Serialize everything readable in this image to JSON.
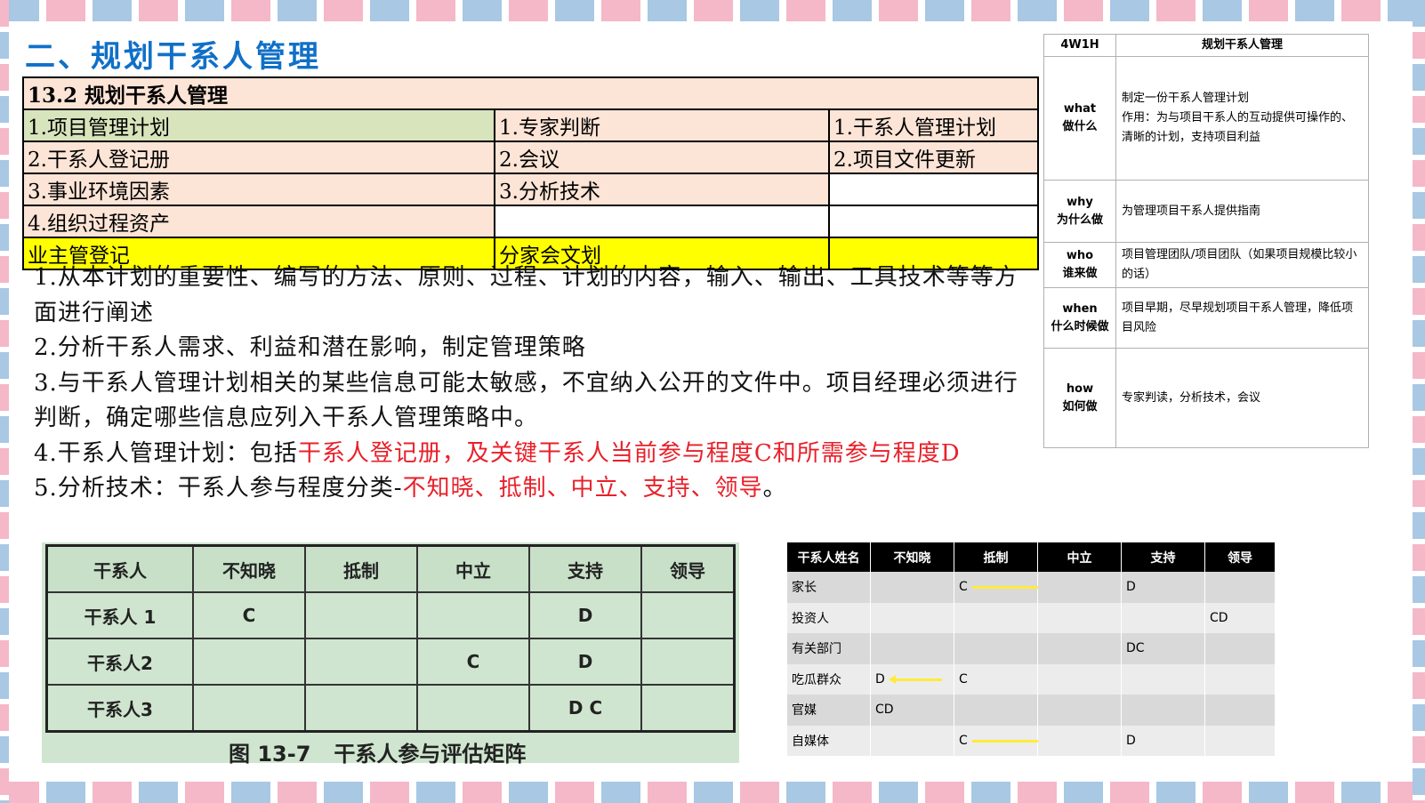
{
  "title": "二、规划干系人管理",
  "itto": {
    "header": "13.2 规划干系人管理",
    "rows": [
      [
        "1.项目管理计划",
        "1.专家判断",
        "1.干系人管理计划"
      ],
      [
        "2.干系人登记册",
        "2.会议",
        "2.项目文件更新"
      ],
      [
        "3.事业环境因素",
        "3.分析技术",
        ""
      ],
      [
        "4.组织过程资产",
        "",
        ""
      ],
      [
        "业主管登记",
        "分家会文划",
        ""
      ]
    ]
  },
  "w4": {
    "header": [
      "4W1H",
      "规划干系人管理"
    ],
    "rows": [
      {
        "k1": "what",
        "k2": "做什么",
        "v": "制定一份干系人管理计划\n作用：为与项目干系人的互动提供可操作的、清晰的计划，支持项目利益"
      },
      {
        "k1": "why",
        "k2": "为什么做",
        "v": "为管理项目干系人提供指南"
      },
      {
        "k1": "who",
        "k2": "谁来做",
        "v": "项目管理团队/项目团队（如果项目规模比较小的话）"
      },
      {
        "k1": "when",
        "k2": "什么时候做",
        "v": "项目早期，尽早规划项目干系人管理，降低项目风险"
      },
      {
        "k1": "how",
        "k2": "如何做",
        "v": "专家判读，分析技术，会议"
      }
    ]
  },
  "notes": {
    "n1": "1.从本计划的重要性、编写的方法、原则、过程、计划的内容，输入、输出、工具技术等等方面进行阐述",
    "n2": "2.分析干系人需求、利益和潜在影响，制定管理策略",
    "n3": "3.与干系人管理计划相关的某些信息可能太敏感，不宜纳入公开的文件中。项目经理必须进行判断，确定哪些信息应列入干系人管理策略中。",
    "n4a": "4.干系人管理计划：包括",
    "n4b": "干系人登记册，及关键干系人当前参与程度C和所需参与程度D",
    "n5a": "5.分析技术：干系人参与程度分类-",
    "n5b": "不知晓、抵制、中立、支持、领导",
    "n5c": "。"
  },
  "matrix": {
    "header": [
      "干系人",
      "不知晓",
      "抵制",
      "中立",
      "支持",
      "领导"
    ],
    "rows": [
      [
        "干系人 1",
        "C",
        "",
        "",
        "D",
        ""
      ],
      [
        "干系人2",
        "",
        "",
        "C",
        "D",
        ""
      ],
      [
        "干系人3",
        "",
        "",
        "",
        "D C",
        ""
      ]
    ],
    "caption_a": "图 13-7",
    "caption_b": "干系人参与评估矩阵"
  },
  "engagement": {
    "header": [
      "干系人姓名",
      "不知晓",
      "抵制",
      "中立",
      "支持",
      "领导"
    ],
    "rows": [
      [
        "家长",
        "",
        "C",
        "",
        "D",
        ""
      ],
      [
        "投资人",
        "",
        "",
        "",
        "",
        "CD"
      ],
      [
        "有关部门",
        "",
        "",
        "",
        "DC",
        ""
      ],
      [
        "吃瓜群众",
        "D",
        "C",
        "",
        "",
        ""
      ],
      [
        "官媒",
        "CD",
        "",
        "",
        "",
        ""
      ],
      [
        "自媒体",
        "",
        "C",
        "",
        "D",
        ""
      ]
    ]
  },
  "colors": {
    "title": "#1070c8",
    "highlight_red": "#e8202a",
    "arrow": "#ffeb3b"
  }
}
